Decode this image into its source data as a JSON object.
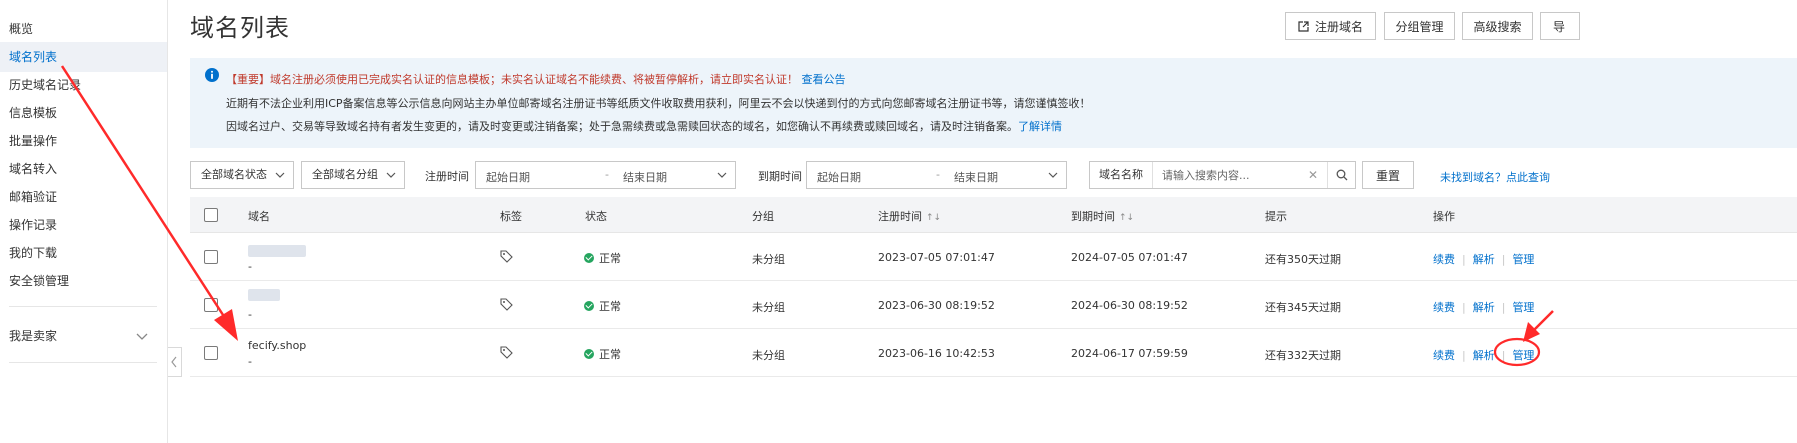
{
  "sidebar": {
    "items": [
      {
        "label": "概览"
      },
      {
        "label": "域名列表"
      },
      {
        "label": "历史域名记录"
      },
      {
        "label": "信息模板"
      },
      {
        "label": "批量操作"
      },
      {
        "label": "域名转入"
      },
      {
        "label": "邮箱验证"
      },
      {
        "label": "操作记录"
      },
      {
        "label": "我的下载"
      },
      {
        "label": "安全锁管理"
      }
    ],
    "seller": "我是卖家"
  },
  "header": {
    "title": "域名列表",
    "buttons": {
      "register": "注册域名",
      "group": "分组管理",
      "advanced": "高级搜索",
      "export": "导"
    }
  },
  "notice": {
    "line1": "【重要】域名注册必须使用已完成实名认证的信息模板；未实名认证域名不能续费、将被暂停解析，请立即实名认证！",
    "line1_link": "查看公告",
    "line2": "近期有不法企业利用ICP备案信息等公示信息向网站主办单位邮寄域名注册证书等纸质文件收取费用获利，阿里云不会以快递到付的方式向您邮寄域名注册证书等，请您谨慎签收！",
    "line3": "因域名过户、交易等导致域名持有者发生变更的，请及时变更或注销备案；处于急需续费或急需赎回状态的域名，如您确认不再续费或赎回域名，请及时注销备案。",
    "line3_link": "了解详情"
  },
  "filters": {
    "status": "全部域名状态",
    "group": "全部域名分组",
    "reg_label": "注册时间",
    "exp_label": "到期时间",
    "start_date": "起始日期",
    "end_date": "结束日期",
    "dash": "-",
    "search_label": "域名名称",
    "search_placeholder": "请输入搜索内容...",
    "reset": "重置",
    "not_found": "未找到域名？点此查询"
  },
  "table": {
    "headers": {
      "domain": "域名",
      "tag": "标签",
      "status": "状态",
      "group": "分组",
      "reg_time": "注册时间",
      "exp_time": "到期时间",
      "tip": "提示",
      "ops": "操作"
    },
    "sort_glyph": "↑↓",
    "rows": [
      {
        "domain": "",
        "sub": "-",
        "status": "正常",
        "group": "未分组",
        "reg": "2023-07-05 07:01:47",
        "exp": "2024-07-05 07:01:47",
        "tip": "还有350天过期",
        "renew": "续费",
        "dns": "解析",
        "manage": "管理"
      },
      {
        "domain": "",
        "sub": "-",
        "status": "正常",
        "group": "未分组",
        "reg": "2023-06-30 08:19:52",
        "exp": "2024-06-30 08:19:52",
        "tip": "还有345天过期",
        "renew": "续费",
        "dns": "解析",
        "manage": "管理"
      },
      {
        "domain": "fecify.shop",
        "sub": "-",
        "status": "正常",
        "group": "未分组",
        "reg": "2023-06-16 10:42:53",
        "exp": "2024-06-17 07:59:59",
        "tip": "还有332天过期",
        "renew": "续费",
        "dns": "解析",
        "manage": "管理"
      }
    ]
  },
  "colors": {
    "link": "#0070cc",
    "active_bg": "#eef1f6",
    "notice_bg": "#edf4fa",
    "ok_green": "#25a55f",
    "annotation_red": "#ff2a2a"
  }
}
